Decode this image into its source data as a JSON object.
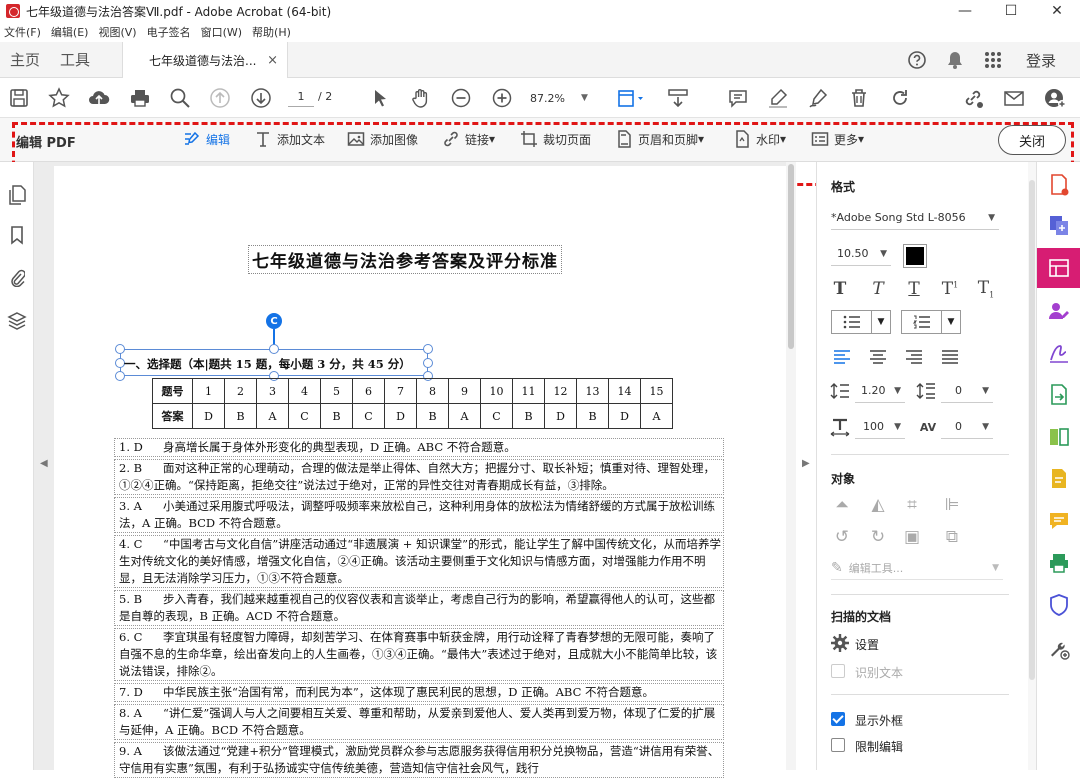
{
  "window": {
    "title": "七年级道德与法治答案Ⅶ.pdf - Adobe Acrobat (64-bit)",
    "controls": [
      "—",
      "☐",
      "✕"
    ]
  },
  "menu": [
    "文件(F)",
    "编辑(E)",
    "视图(V)",
    "电子签名",
    "窗口(W)",
    "帮助(H)"
  ],
  "tabs": {
    "home": "主页",
    "tools": "工具",
    "doc": "七年级道德与法治...",
    "close": "×",
    "login": "登录"
  },
  "toolbar": {
    "page_current": "1",
    "page_total": "/ 2",
    "zoom": "87.2%"
  },
  "editbar": {
    "label": "编辑 PDF",
    "tools": [
      {
        "label": "编辑",
        "icon": "edit-icon"
      },
      {
        "label": "添加文本",
        "icon": "text-icon"
      },
      {
        "label": "添加图像",
        "icon": "image-icon"
      },
      {
        "label": "链接",
        "icon": "link-icon",
        "caret": "▾"
      },
      {
        "label": "裁切页面",
        "icon": "crop-icon"
      },
      {
        "label": "页眉和页脚",
        "icon": "header-footer-icon",
        "caret": "▾"
      },
      {
        "label": "水印",
        "icon": "watermark-icon",
        "caret": "▾"
      },
      {
        "label": "更多",
        "icon": "more-icon",
        "caret": "▾"
      }
    ],
    "close": "关闭"
  },
  "document": {
    "title": "七年级道德与法治参考答案及评分标准",
    "rotate": "C",
    "section1": "一、选择题（本|题共 15 题，每小题 3 分，共 45 分）",
    "table": {
      "header_label": "题号",
      "answer_label": "答案",
      "numbers": [
        "1",
        "2",
        "3",
        "4",
        "5",
        "6",
        "7",
        "8",
        "9",
        "10",
        "11",
        "12",
        "13",
        "14",
        "15"
      ],
      "answers": [
        "D",
        "B",
        "A",
        "C",
        "B",
        "C",
        "D",
        "B",
        "A",
        "C",
        "B",
        "D",
        "B",
        "D",
        "A"
      ]
    },
    "items": [
      {
        "num": "1.  D",
        "text": "身高增长属于身体外形变化的典型表现，D 正确。ABC 不符合题意。"
      },
      {
        "num": "2.  B",
        "text": "面对这种正常的心理萌动，合理的做法是举止得体、自然大方；把握分寸、取长补短；慎重对待、理智处理，①②④正确。“保持距离，拒绝交往”说法过于绝对，正常的异性交往对青春期成长有益，③排除。"
      },
      {
        "num": "3.  A",
        "text": "小美通过采用腹式呼吸法，调整呼吸频率来放松自己，这种利用身体的放松法为情绪舒缓的方式属于放松训练法，A 正确。BCD 不符合题意。"
      },
      {
        "num": "4.  C",
        "text": "“中国考古与文化自信”讲座活动通过“非遗展演 + 知识课堂”的形式，能让学生了解中国传统文化，从而培养学生对传统文化的美好情感，增强文化自信，②④正确。该活动主要侧重于文化知识与情感方面，对增强能力作用不明显，且无法消除学习压力，①③不符合题意。"
      },
      {
        "num": "5.  B",
        "text": "步入青春，我们越来越重视自己的仪容仪表和言谈举止，考虑自己行为的影响，希望赢得他人的认可，这些都是自尊的表现，B 正确。ACD 不符合题意。"
      },
      {
        "num": "6.  C",
        "text": "李宜琪虽有轻度智力障碍，却刻苦学习、在体育赛事中斩获金牌，用行动诠释了青春梦想的无限可能，奏响了自强不息的生命华章，绘出奋发向上的人生画卷，①③④正确。“最伟大”表述过于绝对，且成就大小不能简单比较，该说法错误，排除②。"
      },
      {
        "num": "7.  D",
        "text": "中华民族主张“治国有常，而利民为本”，这体现了惠民利民的思想，D 正确。ABC 不符合题意。"
      },
      {
        "num": "8.  A",
        "text": "“讲仁爱”强调人与人之间要相互关爱、尊重和帮助，从爱亲到爱他人、爱人类再到爱万物，体现了仁爱的扩展与延伸，A 正确。BCD 不符合题意。"
      },
      {
        "num": "9.  A",
        "text": "该做法通过“党建+积分”管理模式，激励党员群众参与志愿服务获得信用积分兑换物品，营造“讲信用有荣誉、守信用有实惠”氛围，有利于弘扬诚实守信传统美德，营造知信守信社会风气，践行"
      }
    ]
  },
  "panel": {
    "format_title": "格式",
    "font": "*Adobe Song Std L-8056",
    "font_size": "10.50",
    "text_color": "#000000",
    "line_spacing": "1.20",
    "para_spacing": "0",
    "h_scale": "100",
    "char_spacing": "0",
    "objects_title": "对象",
    "edit_tool": "编辑工具...",
    "scan_title": "扫描的文档",
    "settings": "设置",
    "ocr": "识别文本",
    "show_bbox": "显示外框",
    "restrict": "限制编辑"
  },
  "colors": {
    "accent": "#1473e6",
    "brand": "#d71d73",
    "highlight_dash": "#e01515"
  }
}
